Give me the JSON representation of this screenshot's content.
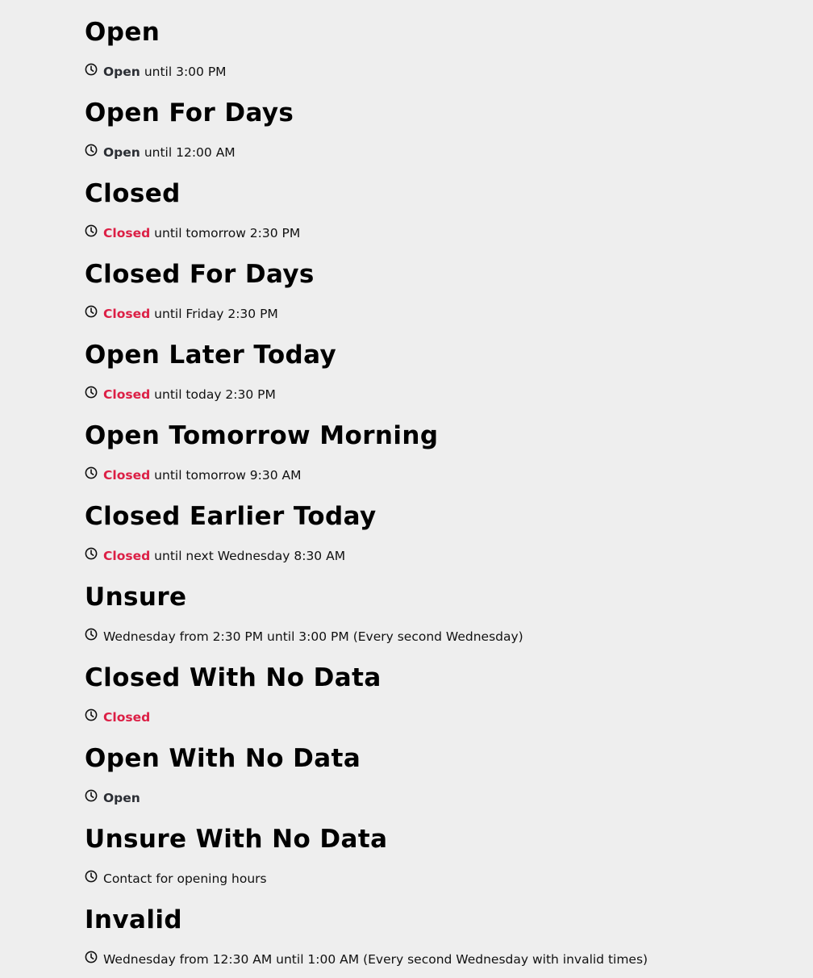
{
  "colors": {
    "background": "#eeeeee",
    "heading": "#000000",
    "open_status": "#2b2e34",
    "closed_status": "#dc1f45",
    "text": "#111111"
  },
  "icons": {
    "clock": "clock-icon"
  },
  "entries": [
    {
      "title": "Open",
      "status": "Open",
      "status_type": "open",
      "text": "until 3:00 PM"
    },
    {
      "title": "Open For Days",
      "status": "Open",
      "status_type": "open",
      "text": "until 12:00 AM"
    },
    {
      "title": "Closed",
      "status": "Closed",
      "status_type": "closed",
      "text": "until tomorrow 2:30 PM"
    },
    {
      "title": "Closed For Days",
      "status": "Closed",
      "status_type": "closed",
      "text": "until Friday 2:30 PM"
    },
    {
      "title": "Open Later Today",
      "status": "Closed",
      "status_type": "closed",
      "text": "until today 2:30 PM"
    },
    {
      "title": "Open Tomorrow Morning",
      "status": "Closed",
      "status_type": "closed",
      "text": "until tomorrow 9:30 AM"
    },
    {
      "title": "Closed Earlier Today",
      "status": "Closed",
      "status_type": "closed",
      "text": "until next Wednesday 8:30 AM"
    },
    {
      "title": "Unsure",
      "status": "",
      "status_type": "none",
      "text": "Wednesday from 2:30 PM until 3:00 PM (Every second Wednesday)"
    },
    {
      "title": "Closed With No Data",
      "status": "Closed",
      "status_type": "closed",
      "text": ""
    },
    {
      "title": "Open With No Data",
      "status": "Open",
      "status_type": "open",
      "text": ""
    },
    {
      "title": "Unsure With No Data",
      "status": "",
      "status_type": "none",
      "text": "Contact for opening hours"
    },
    {
      "title": "Invalid",
      "status": "",
      "status_type": "none",
      "text": "Wednesday from 12:30 AM until 1:00 AM (Every second Wednesday with invalid times)"
    }
  ]
}
